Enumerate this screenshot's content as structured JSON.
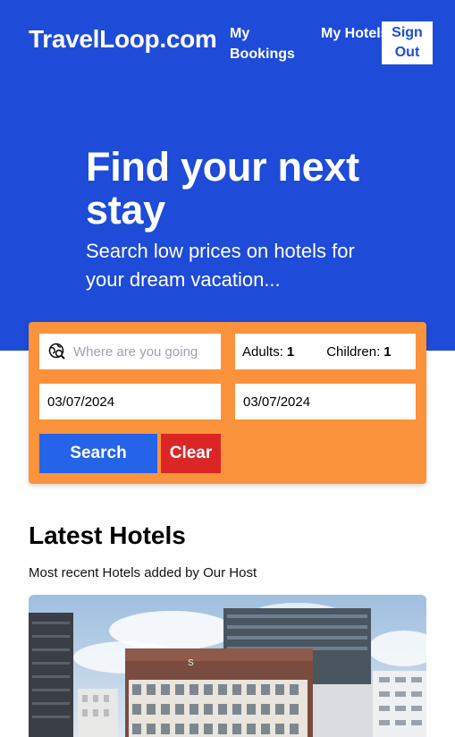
{
  "header": {
    "logo": "TravelLoop.com",
    "nav": {
      "my_bookings": "My Bookings",
      "my_hotels": "My Hotels",
      "sign_out": "Sign Out"
    }
  },
  "hero": {
    "title": "Find your next stay",
    "subtitle": "Search low prices on hotels for your dream vacation..."
  },
  "search": {
    "destination_placeholder": "Where are you going",
    "destination_icon": "map-search-icon",
    "adults_label": "Adults:",
    "adults_value": "1",
    "children_label": "Children:",
    "children_value": "1",
    "check_in": "03/07/2024",
    "check_out": "03/07/2024",
    "search_label": "Search",
    "clear_label": "Clear"
  },
  "latest": {
    "title": "Latest Hotels",
    "subtitle": "Most recent Hotels added by Our Host"
  },
  "colors": {
    "primary": "#1e4bd8",
    "search_button": "#2563eb",
    "panel": "#fb923c",
    "clear_button": "#dc2626"
  }
}
